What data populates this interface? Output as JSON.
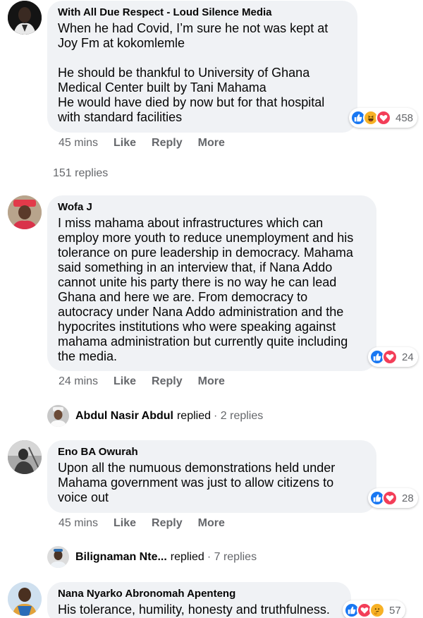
{
  "comments": [
    {
      "author": "With All Due Respect - Loud Silence Media",
      "text": "When he had Covid, I’m sure he not was kept at\nJoy Fm at kokomlemle\n\nHe should be thankful to University of Ghana\nMedical Center built by Tani Mahama\nHe would have died by now but for that hospital\nwith standard facilities",
      "reactions": [
        "like",
        "haha",
        "love"
      ],
      "reaction_count": "458",
      "time": "45 mins",
      "like": "Like",
      "reply": "Reply",
      "more": "More",
      "replies_link": "151 replies"
    },
    {
      "author": "Wofa J",
      "text": "I miss mahama about infrastructures which can\nemploy more youth to reduce unemployment and his\ntolerance on pure leadership in democracy. Mahama\nsaid something in an interview that, if Nana Addo\ncannot unite his party there is no way he can lead\nGhana and here we are. From democracy to\nautocracy under Nana Addo administration and the\nhypocrites institutions who were speaking against\nmahama administration but currently quite including\nthe media.",
      "reactions": [
        "like",
        "love"
      ],
      "reaction_count": "24",
      "time": "24 mins",
      "like": "Like",
      "reply": "Reply",
      "more": "More",
      "reply_summary": {
        "name": "Abdul Nasir Abdul",
        "verb": "replied",
        "count": "· 2 replies"
      }
    },
    {
      "author": "Eno BA Owurah",
      "text": "Upon all the numuous demonstrations held under\nMahama government was just to allow citizens to\nvoice out",
      "reactions": [
        "like",
        "love"
      ],
      "reaction_count": "28",
      "time": "45 mins",
      "like": "Like",
      "reply": "Reply",
      "more": "More",
      "reply_summary": {
        "name": "Bilignaman Nte...",
        "verb": "replied",
        "count": "· 7 replies"
      }
    },
    {
      "author": "Nana Nyarko Abronomah Apenteng",
      "text": "His tolerance, humility, honesty and truthfulness.",
      "reactions": [
        "like",
        "love",
        "thinking"
      ],
      "reaction_count": "57"
    }
  ],
  "colors": {
    "bubble": "#f0f2f5",
    "secondary_text": "#65676b",
    "like_blue": "#1877f2",
    "love_red": "#f33e58",
    "haha_yellow": "#f7b125"
  },
  "icons": {
    "like": "thumbs-up-icon",
    "love": "heart-icon",
    "haha": "laughing-face-icon",
    "thinking": "thinking-face-icon"
  }
}
